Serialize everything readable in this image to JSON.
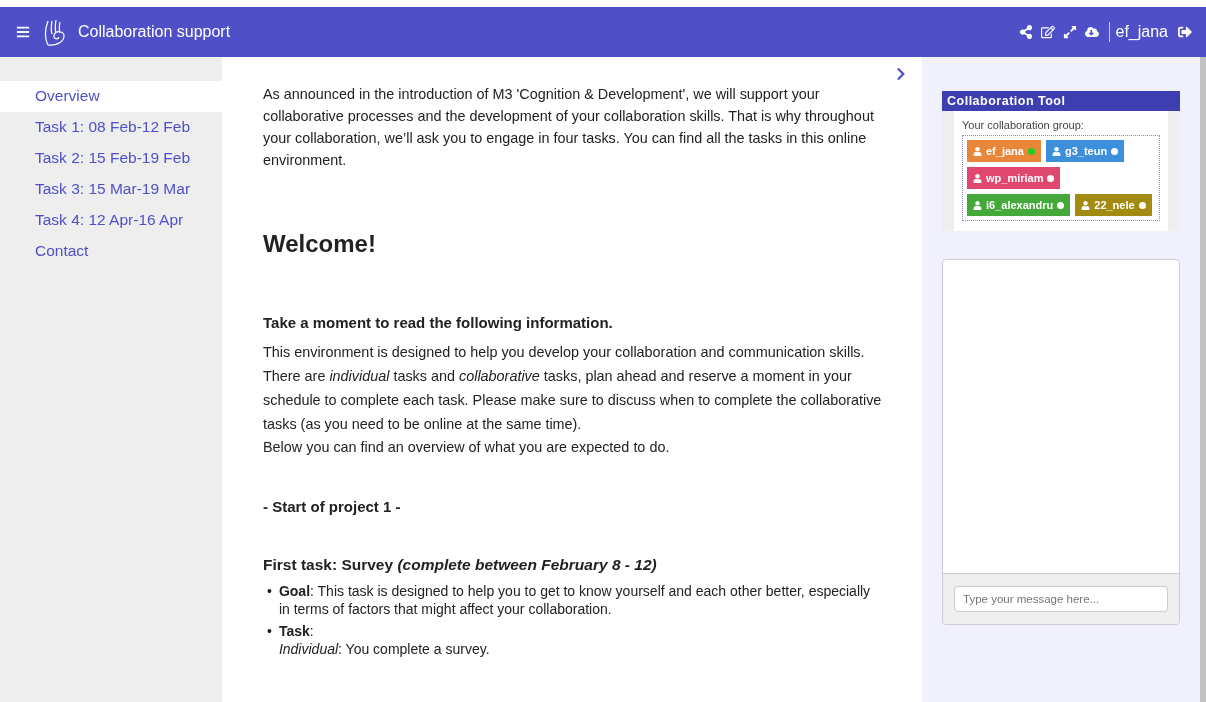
{
  "header": {
    "title": "Collaboration support",
    "user": "ef_jana"
  },
  "sidebar": {
    "items": [
      {
        "label": "Overview",
        "selected": true
      },
      {
        "label": "Task 1: 08 Feb-12 Feb",
        "selected": false
      },
      {
        "label": "Task 2: 15 Feb-19 Feb",
        "selected": false
      },
      {
        "label": "Task 3: 15 Mar-19 Mar",
        "selected": false
      },
      {
        "label": "Task 4: 12 Apr-16 Apr",
        "selected": false
      },
      {
        "label": "Contact",
        "selected": false
      }
    ]
  },
  "content": {
    "intro": "As announced in the introduction of M3 'Cognition & Development', we will support your collaborative processes and the development of your collaboration skills. That is why throughout your collaboration, we’ll ask you to engage in four tasks. You can find all the tasks in this online environment.",
    "heading": "Welcome!",
    "subheading": "Take a moment to read the following information.",
    "body": "This environment is designed to help you develop your collaboration and communication skills. There are *individual* tasks and *collaborative* tasks, plan ahead and reserve a moment in your schedule to complete each task. Please make sure to discuss when to complete the collaborative tasks (as you need to be online at the same time).",
    "body2": "Below you can find an overview of what you are expected to do.",
    "project": "- Start of project 1 -",
    "task_title": "First task: Survey *(complete between February 8 - 12)*",
    "bullet_marker": "•",
    "bullets": [
      "**Goal**: This task is designed to help you to get to know yourself and each other better, especially in terms of factors that might affect your collaboration.",
      "**Task**:"
    ],
    "bullet_note": "*Individual*: You complete a survey."
  },
  "collab_tool": {
    "title": "Collaboration Tool",
    "group_label": "Your collaboration group:",
    "members": [
      {
        "name": "ef_jana",
        "color": "#e8873a",
        "online": true
      },
      {
        "name": "g3_teun",
        "color": "#3d8fdb",
        "online": false
      },
      {
        "name": "wp_miriam",
        "color": "#e0486f",
        "online": false
      },
      {
        "name": "i6_alexandru",
        "color": "#44a83a",
        "online": false
      },
      {
        "name": "22_nele",
        "color": "#a38b12",
        "online": false
      }
    ]
  },
  "chat": {
    "placeholder": "Type your message here..."
  }
}
